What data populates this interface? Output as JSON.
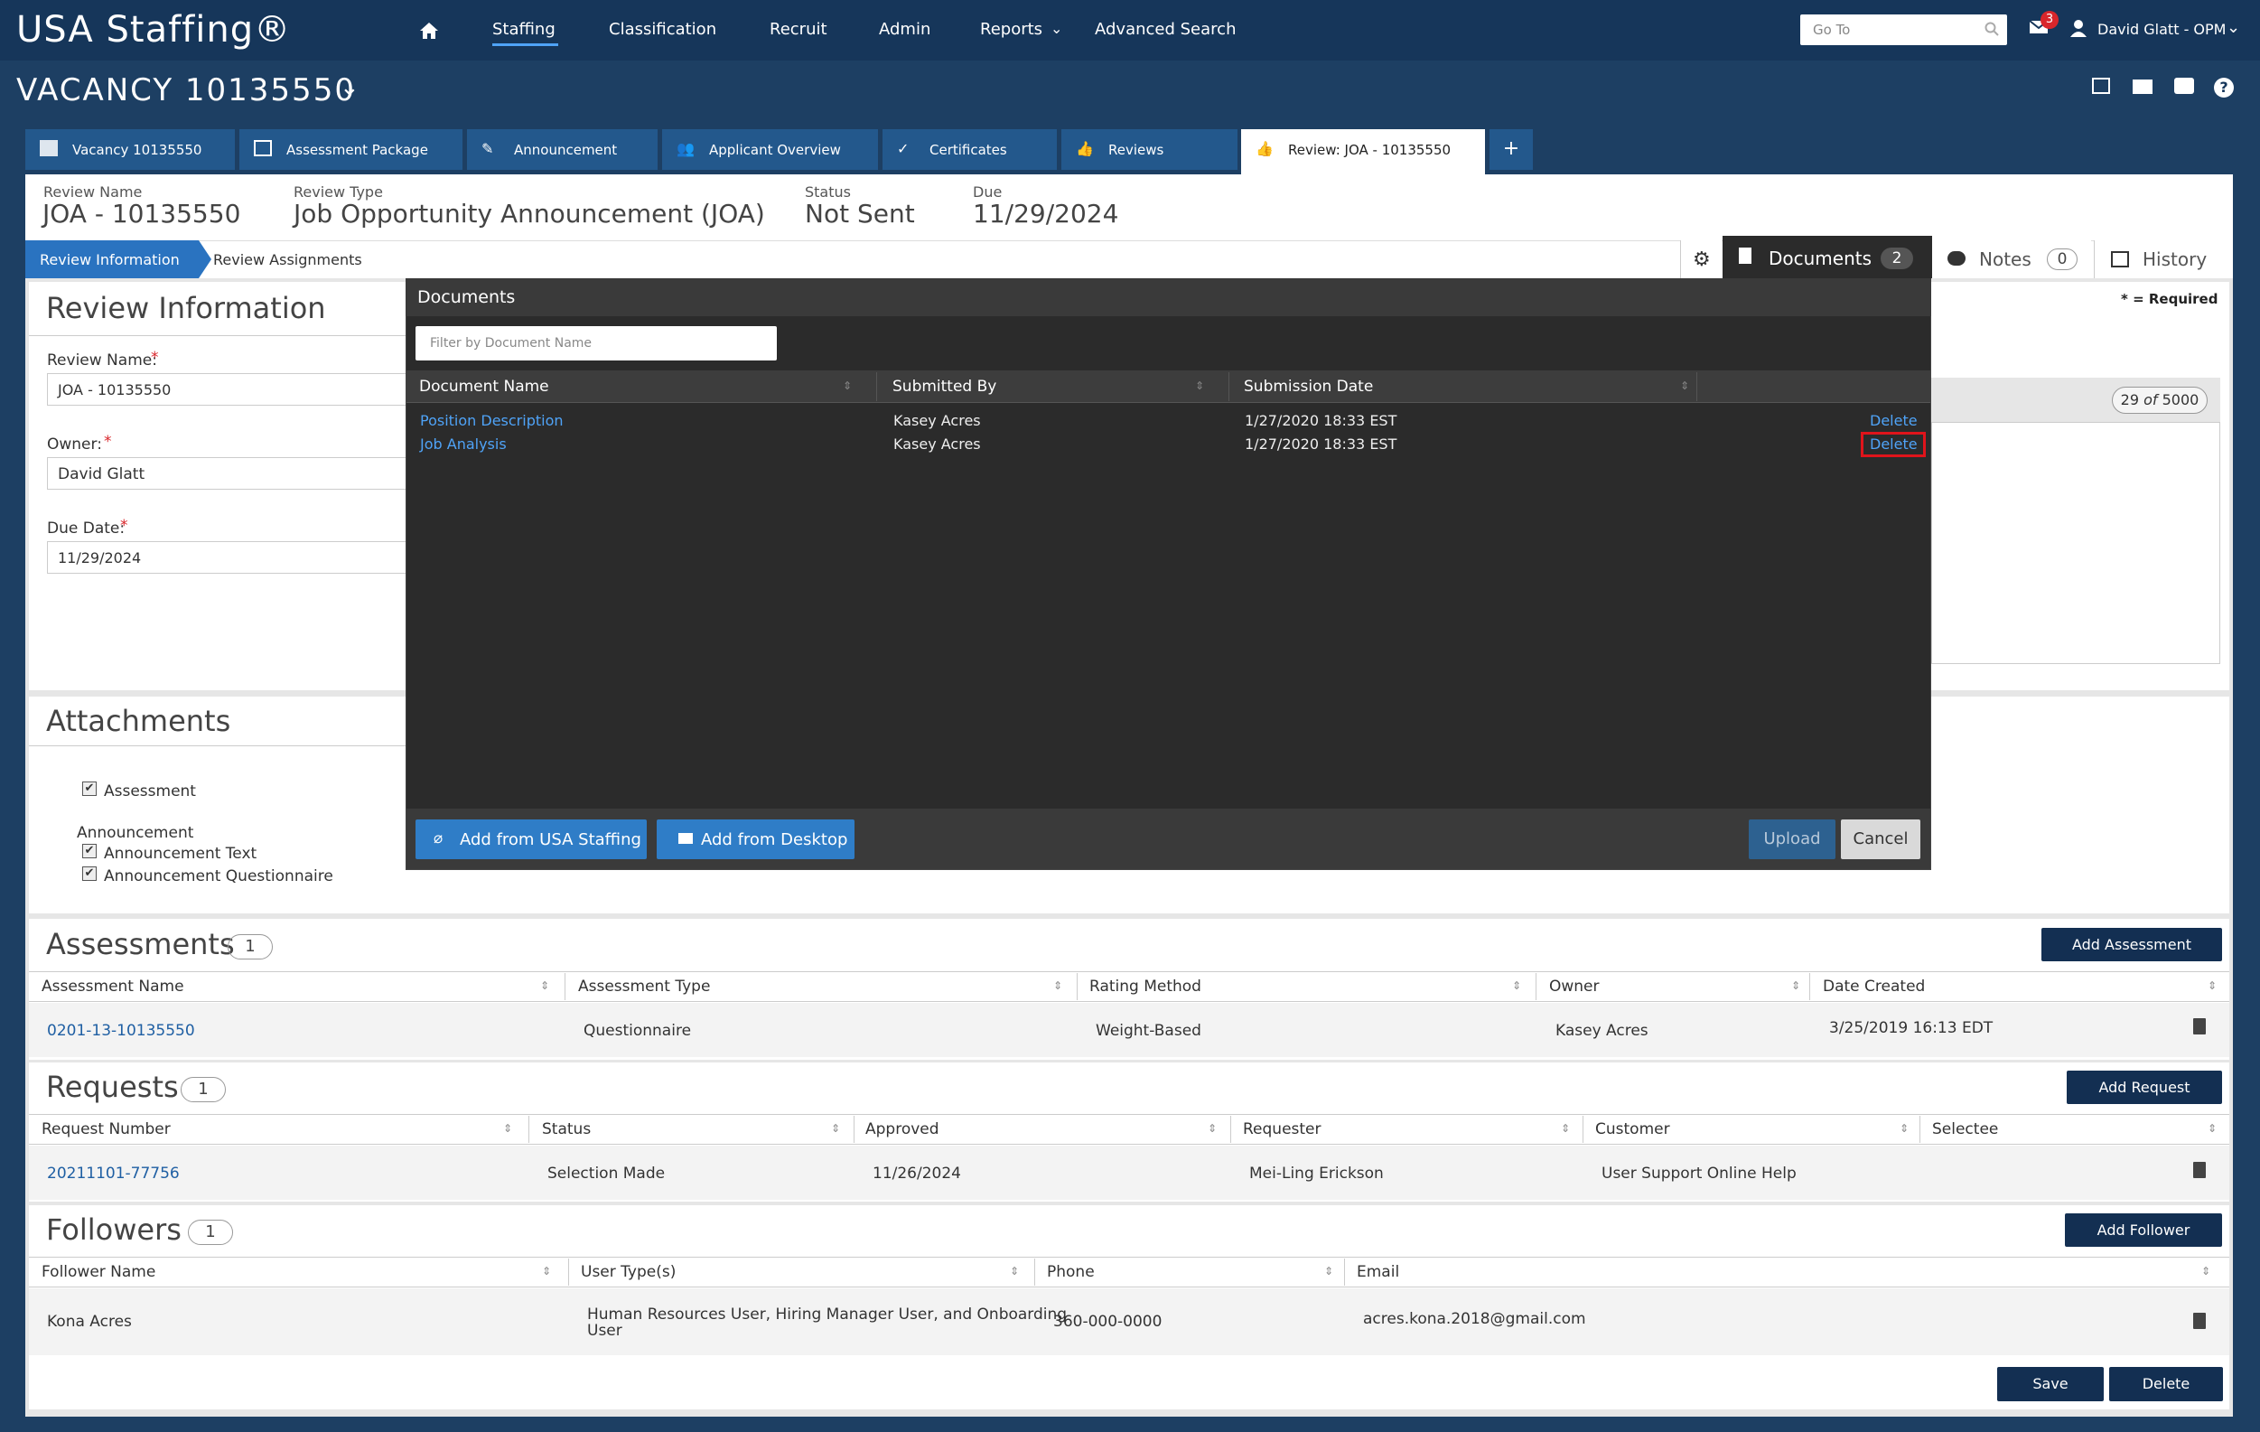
{
  "app": {
    "logo": "USA Staffing®"
  },
  "nav": {
    "items": [
      "Staffing",
      "Classification",
      "Recruit",
      "Admin",
      "Reports",
      "Advanced Search"
    ],
    "goto_placeholder": "Go To",
    "mail_count": "3",
    "user": "David Glatt - OPM"
  },
  "vacancy": {
    "title": "VACANCY 10135550"
  },
  "tabs": [
    "Vacancy 10135550",
    "Assessment Package",
    "Announcement",
    "Applicant Overview",
    "Certificates",
    "Reviews",
    "Review: JOA - 10135550"
  ],
  "review_meta": {
    "name_label": "Review Name",
    "name": "JOA - 10135550",
    "type_label": "Review Type",
    "type": "Job Opportunity Announcement (JOA)",
    "status_label": "Status",
    "status": "Not Sent",
    "due_label": "Due",
    "due": "11/29/2024"
  },
  "subtabs": {
    "info": "Review Information",
    "assign": "Review Assignments"
  },
  "side_tabs": {
    "documents": "Documents",
    "documents_count": "2",
    "notes": "Notes",
    "notes_count": "0",
    "history": "History"
  },
  "review_info": {
    "title": "Review Information",
    "required": "* = Required",
    "name_label": "Review Name:",
    "name_value": "JOA - 10135550",
    "owner_label": "Owner:",
    "owner_value": "David Glatt",
    "due_label": "Due Date:",
    "due_value": "11/29/2024",
    "char_count": "29",
    "char_of": "of",
    "char_max": "5000"
  },
  "attachments": {
    "title": "Attachments",
    "assessment": "Assessment",
    "announcement": "Announcement",
    "announcement_text": "Announcement Text",
    "announcement_questionnaire": "Announcement Questionnaire"
  },
  "assessments": {
    "title": "Assessments",
    "count": "1",
    "add": "Add Assessment",
    "headers": [
      "Assessment Name",
      "Assessment Type",
      "Rating Method",
      "Owner",
      "Date Created"
    ],
    "row": [
      "0201-13-10135550",
      "Questionnaire",
      "Weight-Based",
      "Kasey Acres",
      "3/25/2019 16:13 EDT"
    ]
  },
  "requests": {
    "title": "Requests",
    "count": "1",
    "add": "Add Request",
    "headers": [
      "Request Number",
      "Status",
      "Approved",
      "Requester",
      "Customer",
      "Selectee"
    ],
    "row": [
      "20211101-77756",
      "Selection Made",
      "11/26/2024",
      "Mei-Ling Erickson",
      "User Support Online Help",
      ""
    ]
  },
  "followers": {
    "title": "Followers",
    "count": "1",
    "add": "Add Follower",
    "headers": [
      "Follower Name",
      "User Type(s)",
      "Phone",
      "Email"
    ],
    "row": [
      "Kona Acres",
      "Human Resources User, Hiring Manager User, and Onboarding",
      "User",
      "360-000-0000",
      "acres.kona.2018@gmail.com"
    ]
  },
  "footer": {
    "save": "Save",
    "delete": "Delete"
  },
  "modal": {
    "title": "Documents",
    "filter_placeholder": "Filter by Document Name",
    "headers": [
      "Document Name",
      "Submitted By",
      "Submission Date"
    ],
    "rows": [
      {
        "name": "Position Description",
        "by": "Kasey Acres",
        "date": "1/27/2020 18:33 EST",
        "action": "Delete"
      },
      {
        "name": "Job Analysis",
        "by": "Kasey Acres",
        "date": "1/27/2020 18:33 EST",
        "action": "Delete"
      }
    ],
    "add_usa": "Add from USA Staffing",
    "add_desktop": "Add from Desktop",
    "upload": "Upload",
    "cancel": "Cancel"
  }
}
